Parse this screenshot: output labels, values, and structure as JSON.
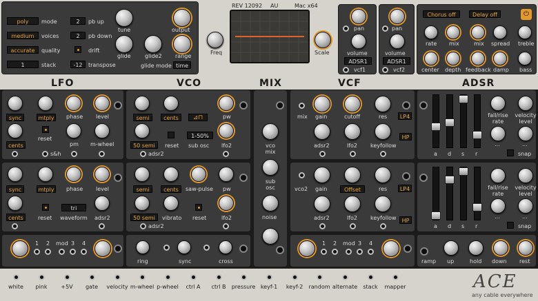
{
  "header": {
    "rev": "REV 12092",
    "format": "AU",
    "platform": "Mac x64"
  },
  "global": {
    "mode": "poly",
    "mode_label": "mode",
    "voices": "medium",
    "voices_label": "voices",
    "quality": "accurate",
    "quality_label": "quality",
    "stack": "1",
    "stack_label": "stack",
    "pbup": "2",
    "pbup_label": "pb up",
    "pbdown": "2",
    "pbdown_label": "pb down",
    "drift_label": "drift",
    "transpose": "-12",
    "transpose_label": "transpose",
    "tune_label": "tune",
    "output_label": "output",
    "glide_label": "glide",
    "glide2_label": "glide2",
    "range_label": "range",
    "glidemode_label": "glide mode",
    "glidemode": "time",
    "freq_label": "Freq",
    "scale_label": "Scale"
  },
  "filters": {
    "pan": "pan",
    "volume": "volume",
    "adsr1": "ADSR1",
    "vcf1": "vcf1",
    "adsr1b": "ADSR1",
    "vcf2": "vcf2"
  },
  "fx": {
    "chorus": "Chorus off",
    "delay": "Delay off",
    "rate": "rate",
    "mix": "mix",
    "mix2": "mix",
    "spread": "spread",
    "treble": "treble",
    "center": "center",
    "depth": "depth",
    "feedback": "feedback",
    "damp": "damp",
    "bass": "bass"
  },
  "sections": {
    "lfo": "LFO",
    "vco": "VCO",
    "mix": "MIX",
    "vcf": "VCF",
    "adsr": "ADSR"
  },
  "lfo1": {
    "sync": "sync",
    "mtply": "mtply",
    "phase": "phase",
    "level": "level",
    "cents": "cents",
    "reset": "reset",
    "pm": "pm",
    "mwheel": "m-wheel",
    "sh": "s&h"
  },
  "lfo2": {
    "sync": "sync",
    "mtply": "mtply",
    "phase": "phase",
    "level": "level",
    "cents": "cents",
    "reset": "reset",
    "waveform": "waveform",
    "wave": "tri",
    "adsr2": "adsr2"
  },
  "vco1": {
    "semi": "semi",
    "cents": "cents",
    "pw": "pw",
    "semi50": "50 semi",
    "reset": "reset",
    "subosc": "sub osc",
    "sub": "1-50%",
    "lfo2": "lfo2",
    "adsr2": "adsr2"
  },
  "vco2": {
    "semi": "semi",
    "cents": "cents",
    "saw": "saw-pulse",
    "pw": "pw",
    "semi50": "50 semi",
    "vibrato": "vibrato",
    "reset": "reset",
    "lfo2": "lfo2",
    "adsr2": "adsr2"
  },
  "vco3": {
    "ring": "ring",
    "sync": "sync",
    "cross": "cross"
  },
  "mixer": {
    "vcomix": "vco mix",
    "subosc": "sub osc",
    "noise": "noise"
  },
  "vcf1": {
    "mix": "mix",
    "gain": "gain",
    "cutoff": "cutoff",
    "res": "res",
    "lp4": "LP4",
    "adsr2": "adsr2",
    "lfo2": "lfo2",
    "keyfollow": "keyfollow",
    "hp": "HP"
  },
  "vcf2": {
    "vco2": "vco2",
    "gain": "gain",
    "offset": "Offset",
    "res": "res",
    "lp4": "LP4",
    "adsr2": "adsr2",
    "lfo2": "lfo2",
    "keyfollow": "keyfollow",
    "hp": "HP"
  },
  "env1": {
    "a": "a",
    "d": "d",
    "s": "s",
    "r": "r",
    "fallrise": "fall/rise rate",
    "velocity": "velocity level",
    "dots": "...",
    "dots2": "...",
    "snap": "snap"
  },
  "env2": {
    "a": "a",
    "d": "d",
    "s": "s",
    "r": "r",
    "fallrise": "fall/rise rate",
    "velocity": "velocity level",
    "dots": "...",
    "dots2": "...",
    "snap": "snap"
  },
  "mod": {
    "n1": "1",
    "n2": "2",
    "mod": "mod",
    "n3": "3",
    "n4": "4"
  },
  "ramp": {
    "ramp": "ramp",
    "up": "up",
    "hold": "hold",
    "down": "down",
    "rest": "rest"
  },
  "sources": [
    "white",
    "pink",
    "+5V",
    "gate",
    "velocity",
    "m-wheel",
    "p-wheel",
    "ctrl A",
    "ctrl B",
    "pressure",
    "keyf-1",
    "keyf-2",
    "random",
    "alternate",
    "stack",
    "mapper"
  ],
  "brand": {
    "logo": "ACE",
    "tagline": "any cable everywhere"
  }
}
